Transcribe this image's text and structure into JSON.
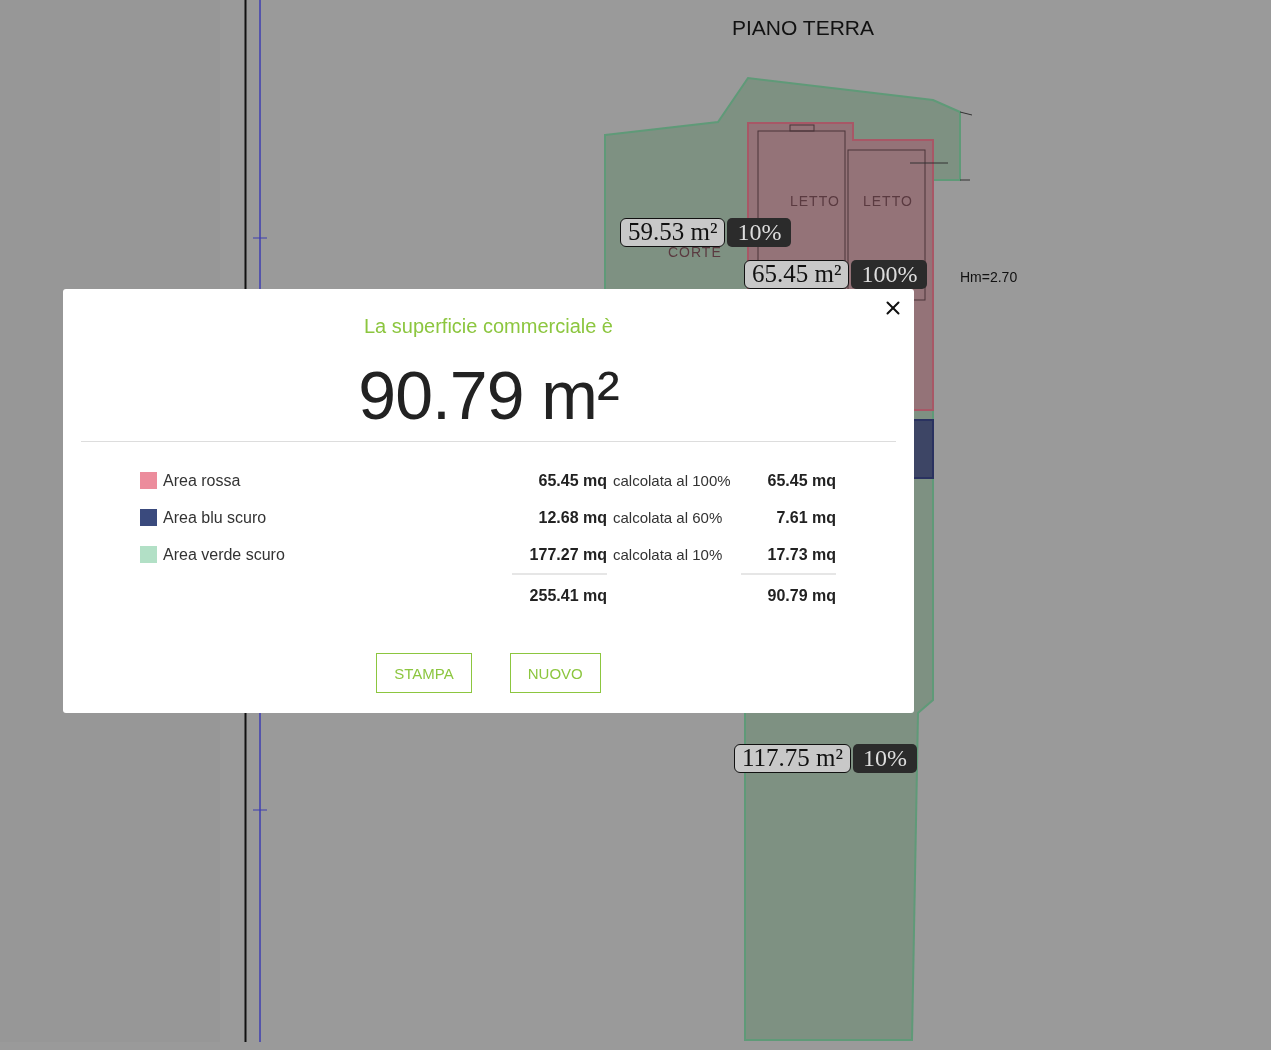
{
  "plan": {
    "title": "PIANO TERRA",
    "rooms": [
      {
        "label": "LETTO"
      },
      {
        "label": "LETTO"
      },
      {
        "label": "CORTE"
      }
    ],
    "area_tags": [
      {
        "area": "59.53 m²",
        "percent": "10%"
      },
      {
        "area": "65.45 m²",
        "percent": "100%"
      },
      {
        "area": "117.75 m²",
        "percent": "10%"
      }
    ],
    "height_note": "Hm=2.70"
  },
  "dialog": {
    "heading": "La superficie commerciale è",
    "total": "90.79 m²",
    "rows": [
      {
        "label": "Area rossa",
        "color": "#ec8c9c",
        "surface": "65.45 mq",
        "rate": "calcolata al 100%",
        "result": "65.45 mq"
      },
      {
        "label": "Area blu scuro",
        "color": "#3a4a7d",
        "surface": "12.68 mq",
        "rate": "calcolata al 60%",
        "result": "7.61 mq"
      },
      {
        "label": "Area verde scuro",
        "color": "#b2e0c6",
        "surface": "177.27 mq",
        "rate": "calcolata al 10%",
        "result": "17.73 mq"
      }
    ],
    "totals": {
      "surface": "255.41 mq",
      "result": "90.79 mq"
    },
    "buttons": [
      "STAMPA",
      "NUOVO"
    ]
  }
}
